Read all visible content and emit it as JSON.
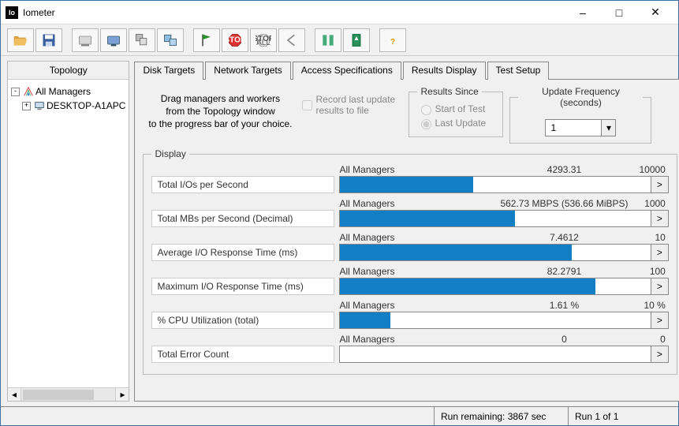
{
  "title": "Iometer",
  "app_icon_text": "Io",
  "topology": {
    "title": "Topology",
    "root": "All Managers",
    "child": "DESKTOP-A1APC"
  },
  "tabs": [
    "Disk Targets",
    "Network Targets",
    "Access Specifications",
    "Results Display",
    "Test Setup"
  ],
  "active_tab": 3,
  "hint_lines": [
    "Drag managers and workers",
    "from the Topology window",
    "to the progress bar of your choice."
  ],
  "record_label": "Record last update results to file",
  "results_since": {
    "legend": "Results Since",
    "opt1": "Start of Test",
    "opt2": "Last Update"
  },
  "update_freq": {
    "legend": "Update Frequency (seconds)",
    "value": "1"
  },
  "display_legend": "Display",
  "metrics": [
    {
      "label": "Total I/Os per Second",
      "scope": "All Managers",
      "value": "4293.31",
      "max": "10000",
      "pct": 42.9
    },
    {
      "label": "Total MBs per Second (Decimal)",
      "scope": "All Managers",
      "value": "562.73 MBPS (536.66 MiBPS)",
      "max": "1000",
      "pct": 56.3
    },
    {
      "label": "Average I/O Response Time (ms)",
      "scope": "All Managers",
      "value": "7.4612",
      "max": "10",
      "pct": 74.6
    },
    {
      "label": "Maximum I/O Response Time (ms)",
      "scope": "All Managers",
      "value": "82.2791",
      "max": "100",
      "pct": 82.3
    },
    {
      "label": "% CPU Utilization (total)",
      "scope": "All Managers",
      "value": "1.61 %",
      "max": "10 %",
      "pct": 16.1
    },
    {
      "label": "Total Error Count",
      "scope": "All Managers",
      "value": "0",
      "max": "0",
      "pct": 0
    }
  ],
  "status": {
    "remaining": "Run remaining: 3867 sec",
    "run": "Run 1 of 1"
  },
  "toolbar_icons": [
    "open-icon",
    "save-icon",
    "new-worker-disk-icon",
    "new-worker-net-icon",
    "duplicate-worker-icon",
    "stack-icon",
    "flag-icon",
    "stop-icon",
    "stop-all-icon",
    "reset-icon",
    "meter-up-icon",
    "meter-down-icon",
    "help-icon"
  ]
}
